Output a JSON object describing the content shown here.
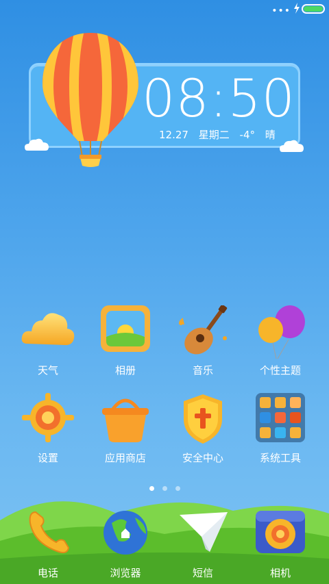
{
  "status_bar": {
    "dots": "•••",
    "battery_level": 1.0,
    "icons": [
      "more-dots-icon",
      "charging-bolt-icon",
      "battery-icon"
    ]
  },
  "clock_widget": {
    "time": "08:50",
    "date": "12.27",
    "weekday": "星期二",
    "temperature": "-4°",
    "weather": "晴"
  },
  "apps": [
    {
      "label": "天气",
      "icon": "weather-cloud-icon"
    },
    {
      "label": "相册",
      "icon": "gallery-icon"
    },
    {
      "label": "音乐",
      "icon": "guitar-music-icon"
    },
    {
      "label": "个性主题",
      "icon": "balloons-theme-icon"
    },
    {
      "label": "设置",
      "icon": "sun-gear-settings-icon"
    },
    {
      "label": "应用商店",
      "icon": "basket-store-icon"
    },
    {
      "label": "安全中心",
      "icon": "shield-security-icon"
    },
    {
      "label": "系统工具",
      "icon": "tools-folder-icon"
    }
  ],
  "page_indicator": {
    "count": 3,
    "active": 0
  },
  "dock": [
    {
      "label": "电话",
      "icon": "phone-icon"
    },
    {
      "label": "浏览器",
      "icon": "globe-browser-icon"
    },
    {
      "label": "短信",
      "icon": "paper-plane-sms-icon"
    },
    {
      "label": "相机",
      "icon": "camera-icon"
    }
  ],
  "colors": {
    "sky_top": "#2f8fe3",
    "sky_bottom": "#7cc2f3",
    "widget_panel": "#54b4f4",
    "battery": "#4cd964",
    "grass": "#6cc83a"
  }
}
